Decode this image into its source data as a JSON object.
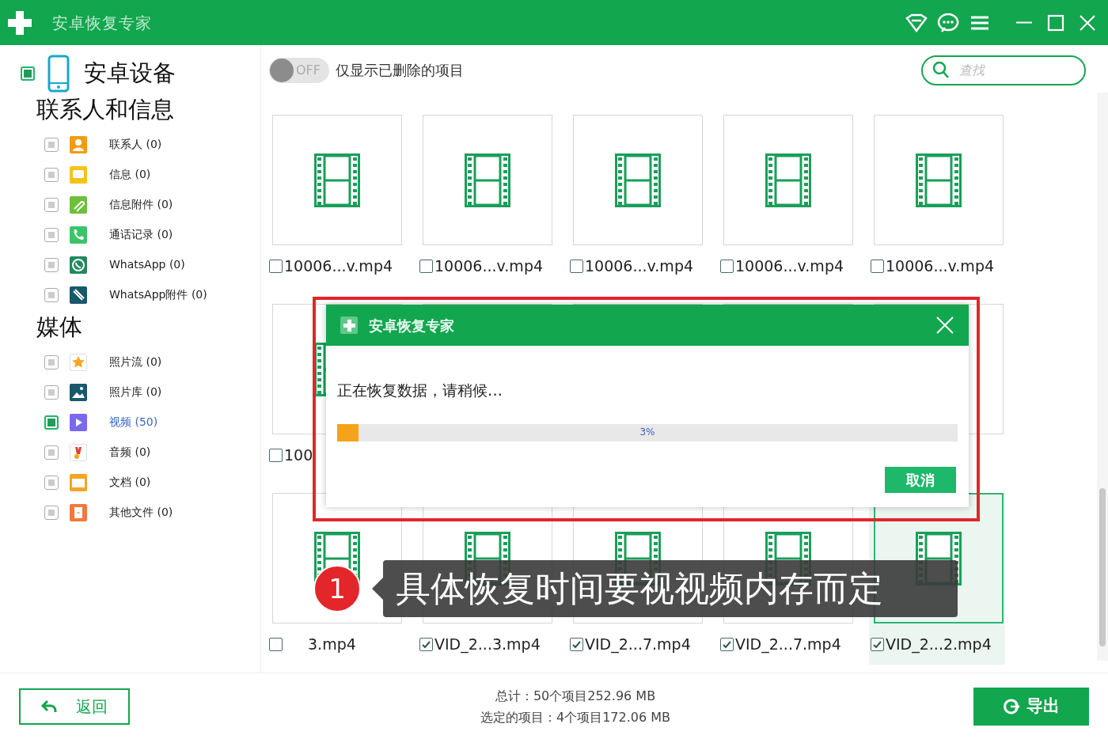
{
  "window": {
    "title": "安卓恢复专家"
  },
  "sidebar": {
    "device": {
      "label": "安卓设备",
      "checked": true
    },
    "groups": [
      {
        "title": "联系人和信息",
        "items": [
          {
            "kind": "contacts",
            "label": "联系人 (0)",
            "checked": false,
            "selected": false,
            "color": "#f39c12"
          },
          {
            "kind": "messages",
            "label": "信息 (0)",
            "checked": false,
            "selected": false,
            "color": "#f7c21a"
          },
          {
            "kind": "attachments",
            "label": "信息附件 (0)",
            "checked": false,
            "selected": false,
            "color": "#6cc13a"
          },
          {
            "kind": "calls",
            "label": "通话记录 (0)",
            "checked": false,
            "selected": false,
            "color": "#3cc46b"
          },
          {
            "kind": "whatsapp",
            "label": "WhatsApp (0)",
            "checked": false,
            "selected": false,
            "color": "#1f8a5c"
          },
          {
            "kind": "whatsapp_attachments",
            "label": "WhatsApp附件 (0)",
            "checked": false,
            "selected": false,
            "color": "#17596b"
          }
        ]
      },
      {
        "title": "媒体",
        "items": [
          {
            "kind": "photo_stream",
            "label": "照片流 (0)",
            "checked": false,
            "selected": false,
            "color": "#f5a623"
          },
          {
            "kind": "gallery",
            "label": "照片库 (0)",
            "checked": false,
            "selected": false,
            "color": "#17596b"
          },
          {
            "kind": "video",
            "label": "视频 (50)",
            "checked": true,
            "selected": true,
            "color": "#7b68ee"
          },
          {
            "kind": "audio",
            "label": "音频 (0)",
            "checked": false,
            "selected": false,
            "color": "#e8412c"
          },
          {
            "kind": "documents",
            "label": "文档 (0)",
            "checked": false,
            "selected": false,
            "color": "#f5a623"
          },
          {
            "kind": "other",
            "label": "其他文件 (0)",
            "checked": false,
            "selected": false,
            "color": "#f07a3a"
          }
        ]
      }
    ]
  },
  "filter": {
    "toggle_text": "OFF",
    "on": false,
    "label": "仅显示已删除的项目"
  },
  "search": {
    "placeholder": "查找"
  },
  "files": [
    {
      "label": "10006...v.mp4",
      "checked": false,
      "selected": false
    },
    {
      "label": "10006...v.mp4",
      "checked": false,
      "selected": false
    },
    {
      "label": "10006...v.mp4",
      "checked": false,
      "selected": false
    },
    {
      "label": "10006...v.mp4",
      "checked": false,
      "selected": false
    },
    {
      "label": "10006...v.mp4",
      "checked": false,
      "selected": false
    },
    {
      "label": "100",
      "checked": false,
      "selected": false
    },
    {
      "selected": false
    },
    {
      "selected": false
    },
    {
      "selected": false
    },
    {
      "selected": false
    },
    {
      "label": "3.mp4",
      "checked": false,
      "selected": false
    },
    {
      "label": "VID_2...3.mp4",
      "checked": true,
      "selected": false
    },
    {
      "label": "VID_2...7.mp4",
      "checked": true,
      "selected": false
    },
    {
      "label": "VID_2...7.mp4",
      "checked": true,
      "selected": false
    },
    {
      "label": "VID_2...2.mp4",
      "checked": true,
      "selected": true
    }
  ],
  "dialog": {
    "title": "安卓恢复专家",
    "message": "正在恢复数据，请稍候…",
    "progress": {
      "level": 0.034,
      "reading": "3%"
    },
    "cancel": "取消"
  },
  "caption": {
    "badge": "1",
    "text": "具体恢复时间要视视频内存而定"
  },
  "footer": {
    "back": "返回",
    "total": "总计：50个项目252.96 MB",
    "selected": "选定的项目：4个项目172.06 MB",
    "export": "导出"
  }
}
